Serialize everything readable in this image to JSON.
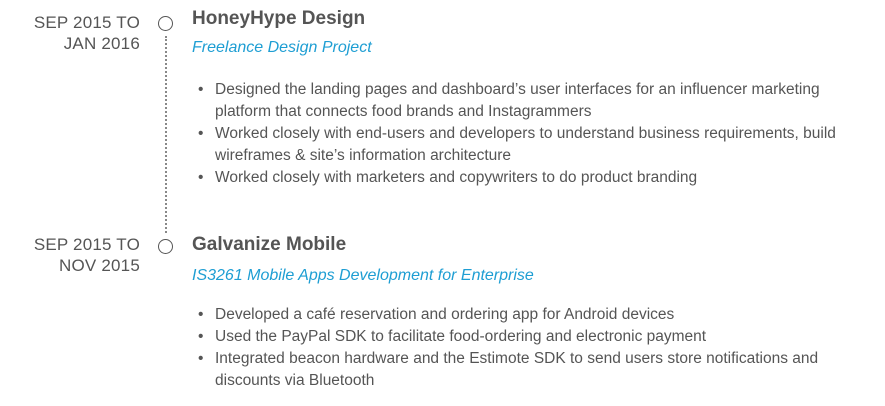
{
  "entries": [
    {
      "date_from": "SEP 2015 TO",
      "date_to": "JAN 2016",
      "company": "HoneyHype Design",
      "role": "Freelance Design Project",
      "bullets": [
        "Designed the landing pages and dashboard’s user interfaces for an influencer marketing platform that connects food brands and Instagrammers",
        "Worked closely with end-users and developers to understand business requirements, build wireframes & site’s information architecture",
        "Worked closely with marketers and copywriters to do product branding"
      ]
    },
    {
      "date_from": "SEP 2015 TO",
      "date_to": "NOV 2015",
      "company": "Galvanize Mobile",
      "role": "IS3261 Mobile Apps Development for Enterprise",
      "bullets": [
        "Developed a café reservation and ordering app for Android devices",
        "Used the PayPal SDK to facilitate food-ordering and electronic payment",
        "Integrated beacon hardware and the Estimote SDK to send users store notifications and discounts via Bluetooth"
      ]
    }
  ],
  "colors": {
    "text": "#555555",
    "accent": "#1e9ed3",
    "timeline": "#888888"
  },
  "icons": {
    "marker": "timeline-circle-icon",
    "bullet": "bullet-dot-icon"
  }
}
